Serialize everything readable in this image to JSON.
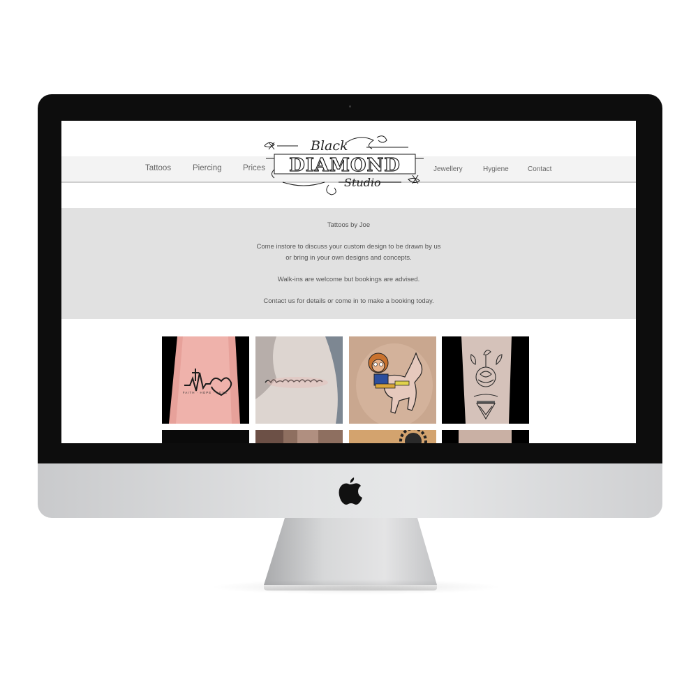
{
  "nav": {
    "left": [
      "Tattoos",
      "Piercing",
      "Prices"
    ],
    "right": [
      "Jewellery",
      "Hygiene",
      "Contact"
    ]
  },
  "logo": {
    "top": "Black",
    "main": "DIAMOND",
    "bottom": "Studio"
  },
  "intro": {
    "heading": "Tattoos by Joe",
    "line1": "Come instore to discuss your custom design to be drawn by us",
    "line2": "or bring in your own designs and concepts.",
    "line3": "Walk-ins are welcome but bookings are advised.",
    "line4": "Contact us for details or come in to make a booking today."
  },
  "gallery": {
    "tile1_caption": "FAITH · HOPE · LOVE"
  },
  "colors": {
    "nav_bg": "#f3f3f3",
    "intro_bg": "#e1e1e1",
    "text": "#555555",
    "bezel": "#0d0d0d"
  },
  "icons": [
    "apple-logo-icon"
  ]
}
